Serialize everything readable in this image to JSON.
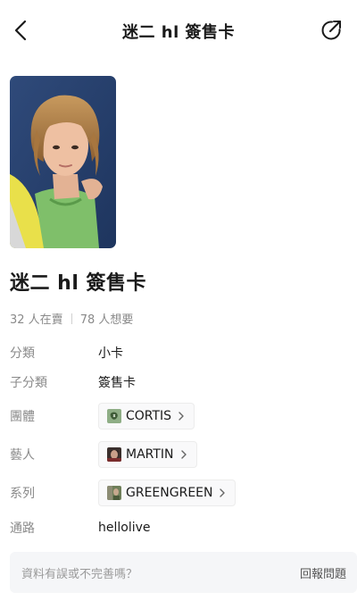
{
  "header": {
    "title": "迷二 hl 簽售卡",
    "back_icon": "chevron-left-icon",
    "share_icon": "share-icon"
  },
  "item": {
    "title": "迷二 hl 簽售卡"
  },
  "stats": {
    "selling": "32 人在賣",
    "wanting": "78 人想要"
  },
  "details": {
    "category": {
      "label": "分類",
      "value": "小卡"
    },
    "subcategory": {
      "label": "子分類",
      "value": "簽售卡"
    },
    "group": {
      "label": "團體",
      "value": "CORTIS"
    },
    "artist": {
      "label": "藝人",
      "value": "MARTIN"
    },
    "series": {
      "label": "系列",
      "value": "GREENGREEN"
    },
    "channel": {
      "label": "通路",
      "value": "hellolive"
    }
  },
  "feedback": {
    "question": "資料有誤或不完善嗎？",
    "action": "回報問題"
  }
}
